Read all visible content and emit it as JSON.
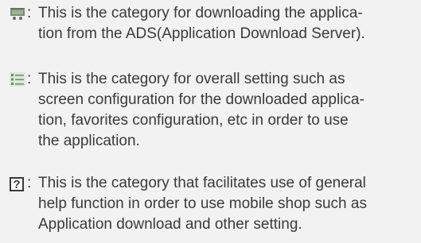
{
  "entries": [
    {
      "icon": "shopping-cart-icon",
      "colon": ":",
      "lines": [
        "This is the category for downloading the applica-",
        "tion from the ADS(Application Download Server)."
      ]
    },
    {
      "icon": "menu-list-icon",
      "colon": ":",
      "lines": [
        "This is the category for overall setting such as",
        "screen configuration for the downloaded applica-",
        "tion, favorites configuration, etc in order to use",
        "the application."
      ]
    },
    {
      "icon": "help-icon",
      "icon_glyph": "?",
      "colon": ":",
      "lines": [
        "This is the category that facilitates use of general",
        "help function in order to use mobile shop such as",
        "Application download and other setting."
      ]
    }
  ]
}
